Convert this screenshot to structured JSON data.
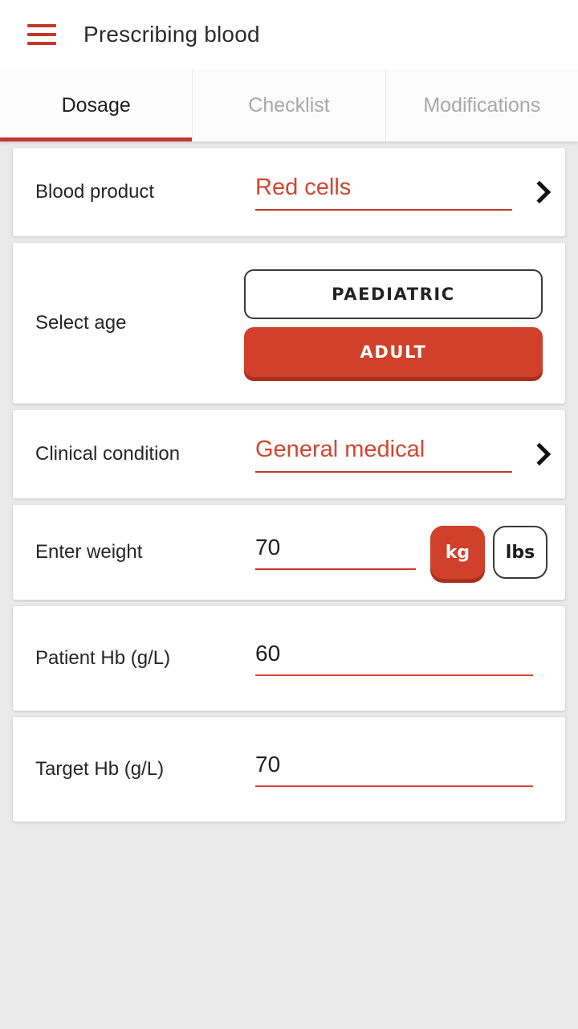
{
  "header": {
    "menu_icon": "hamburger-menu-icon",
    "title": "Prescribing blood"
  },
  "tabs": [
    {
      "label": "Dosage",
      "active": true
    },
    {
      "label": "Checklist",
      "active": false
    },
    {
      "label": "Modifications",
      "active": false
    }
  ],
  "form": {
    "blood_product": {
      "label": "Blood product",
      "value": "Red cells",
      "chevron_icon": "chevron-right-icon"
    },
    "select_age": {
      "label": "Select age",
      "options": [
        {
          "label": "PAEDIATRIC",
          "selected": false
        },
        {
          "label": "ADULT",
          "selected": true
        }
      ]
    },
    "clinical_condition": {
      "label": "Clinical condition",
      "value": "General medical",
      "chevron_icon": "chevron-right-icon"
    },
    "enter_weight": {
      "label": "Enter weight",
      "value": "70",
      "placeholder": "",
      "units": [
        {
          "label": "kg",
          "selected": true
        },
        {
          "label": "lbs",
          "selected": false
        }
      ]
    },
    "patient_hb": {
      "label": "Patient Hb (g/L)",
      "value": "60",
      "placeholder": ""
    },
    "target_hb": {
      "label": "Target Hb (g/L)",
      "value": "70",
      "placeholder": ""
    }
  },
  "colors": {
    "accent_red": "#d0402a",
    "accent_red_dark": "#a8301d",
    "menu_red": "#c0392b",
    "page_background": "#e9e9e9",
    "card_background": "#ffffff",
    "text_primary": "#262626",
    "text_muted": "#a8a8a8"
  }
}
